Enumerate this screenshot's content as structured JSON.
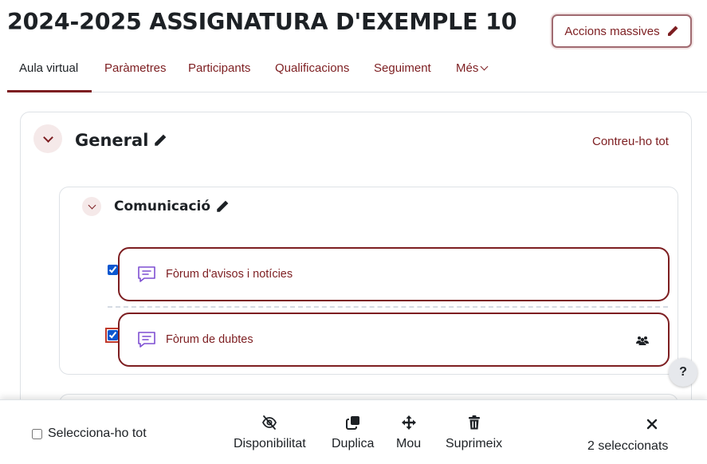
{
  "page": {
    "title": "2024-2025 ASSIGNATURA D'EXEMPLE 10"
  },
  "header": {
    "bulk_actions_label": "Accions massives"
  },
  "nav": {
    "items": [
      {
        "label": "Aula virtual"
      },
      {
        "label": "Paràmetres"
      },
      {
        "label": "Participants"
      },
      {
        "label": "Qualificacions"
      },
      {
        "label": "Seguiment"
      },
      {
        "label": "Més"
      }
    ]
  },
  "section": {
    "title": "General",
    "collapse_all_label": "Contreu-ho tot",
    "subsection": {
      "title": "Comunicació",
      "activities": [
        {
          "name": "Fòrum d'avisos i notícies",
          "checked": true
        },
        {
          "name": "Fòrum de dubtes",
          "checked": true
        }
      ]
    }
  },
  "help": {
    "label": "?"
  },
  "footer": {
    "select_all_label": "Selecciona-ho tot",
    "actions": [
      {
        "label": "Disponibilitat",
        "icon": "eye-slash-icon"
      },
      {
        "label": "Duplica",
        "icon": "copy-icon"
      },
      {
        "label": "Mou",
        "icon": "move-icon"
      },
      {
        "label": "Suprimeix",
        "icon": "trash-icon"
      }
    ],
    "selected_count_label": "2 seleccionats"
  },
  "colors": {
    "accent": "#7d1e21",
    "forum_icon": "#7e4fd2",
    "text": "#1d2125"
  }
}
